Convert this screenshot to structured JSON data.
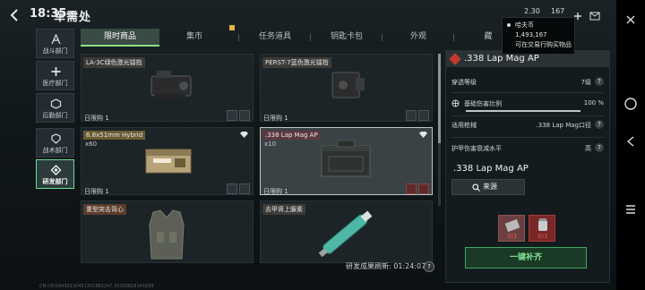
{
  "header": {
    "clock": "18:35",
    "title": "军需处",
    "currency_1": "2.30",
    "currency_2": "167"
  },
  "tooltip": {
    "location": "哈夫币",
    "amount": "1,493,167",
    "note": "可在交易行购买物品"
  },
  "leftnav": {
    "items": [
      {
        "label": "战斗部门",
        "icon": "a-arrow-icon"
      },
      {
        "label": "医疗部门",
        "icon": "cross-icon"
      },
      {
        "label": "后勤部门",
        "icon": "hex-icon"
      },
      {
        "label": "战术部门",
        "icon": "shield-icon"
      },
      {
        "label": "研发部门",
        "icon": "diamond-gear-icon"
      }
    ],
    "active_index": 4
  },
  "tabs": [
    {
      "label": "限时商品"
    },
    {
      "label": "集市"
    },
    {
      "label": "任务道具"
    },
    {
      "label": "钥匙卡包"
    },
    {
      "label": "外观"
    },
    {
      "label": "藏"
    }
  ],
  "cards": [
    {
      "name": "LA-3C绿色激光镭指",
      "count": "",
      "limit": "日限购 1"
    },
    {
      "name": "PERST-7蓝色激光镭指",
      "count": "",
      "limit": "日限购 1"
    },
    {
      "name": "6.8x51mm Hybrid",
      "count": "x60",
      "limit": "日限购 1"
    },
    {
      "name": ".338 Lap Mag AP",
      "count": "x10",
      "limit": "日限购 1"
    },
    {
      "name": "重型突击背心",
      "count": "",
      "limit": ""
    },
    {
      "name": "去甲肾上腺素",
      "count": "",
      "limit": ""
    }
  ],
  "refresh": {
    "label": "研发成果刷新: 01:24:07",
    "help": "?"
  },
  "detail": {
    "title": ".338 Lap Mag AP",
    "attrs": [
      {
        "k": "穿透等级",
        "v": "7级"
      },
      {
        "k": "基础伤害比例",
        "v": "100 %"
      },
      {
        "k": "适用枪械",
        "v": ".338 Lap Mag口径"
      },
      {
        "k": "护甲伤害衰减水平",
        "v": "高"
      }
    ],
    "base_damage_fraction": 1.0,
    "item_name": ".338 Lap Mag AP",
    "source_btn": "来源",
    "ammo_slots": [
      "0/1",
      "0/1"
    ],
    "restock_btn": "一键补齐"
  },
  "debug": "CN UID18939130451351882247 20250818141839",
  "colors": {
    "accent_green": "#66e08c",
    "danger_red": "#c0392b",
    "panel_bg": "#141b1e"
  }
}
